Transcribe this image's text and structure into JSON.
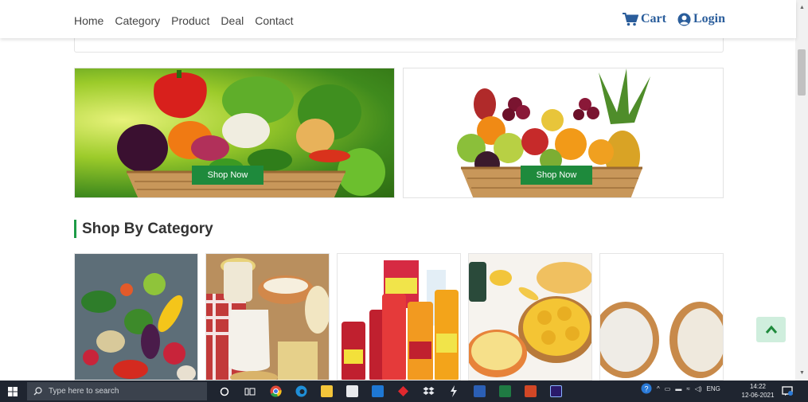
{
  "nav": {
    "links": [
      "Home",
      "Category",
      "Product",
      "Deal",
      "Contact"
    ],
    "cart_label": "Cart",
    "login_label": "Login"
  },
  "banners": [
    {
      "button_label": "Shop Now"
    },
    {
      "button_label": "Shop Now"
    }
  ],
  "section": {
    "title": "Shop By Category"
  },
  "taskbar": {
    "search_placeholder": "Type here to search",
    "language": "ENG",
    "time": "14:22",
    "date": "12-06-2021"
  },
  "colors": {
    "brand_blue": "#2a5d9b",
    "accent_green": "#1e8a3c",
    "section_bar": "#1e9b47",
    "scroll_top_bg": "#cfeedd"
  }
}
